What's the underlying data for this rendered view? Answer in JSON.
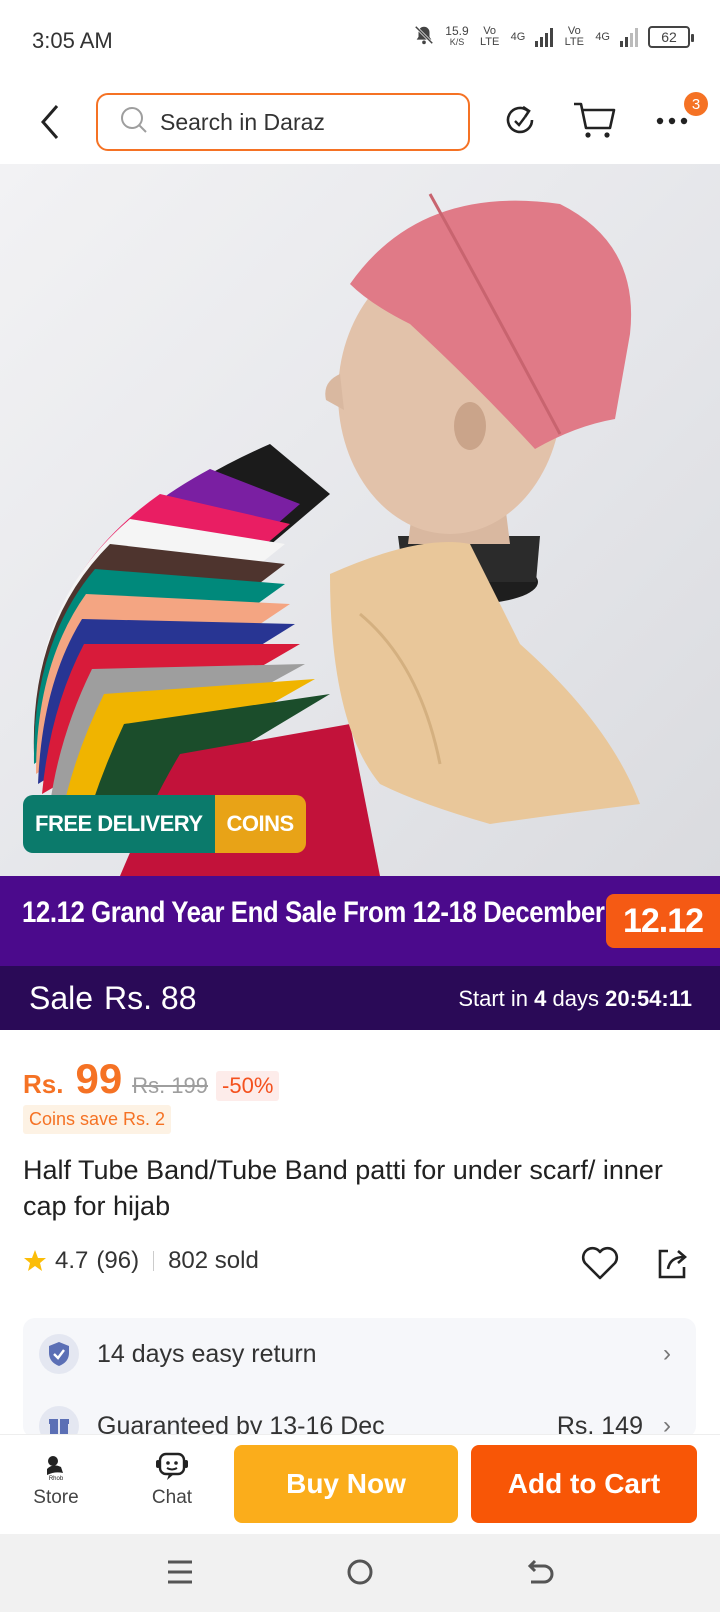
{
  "status_bar": {
    "time": "3:05 AM",
    "net_speed": "15.9",
    "net_unit": "K/S",
    "sim1_label": "Vo LTE",
    "sim1_network": "4G",
    "sim2_label": "Vo LTE",
    "sim2_network": "4G",
    "battery": "62"
  },
  "top_nav": {
    "search_placeholder": "Search in Daraz",
    "more_badge": "3"
  },
  "product_image": {
    "badges": {
      "free_delivery": "FREE DELIVERY",
      "coins": "COINS"
    },
    "colors": {
      "free_delivery": "#0b7a6b",
      "coins": "#e8a317"
    }
  },
  "campaign": {
    "banner_text": "12.12 Grand Year End Sale From 12-18 December",
    "logo_text": "12.12",
    "sale_label": "Sale",
    "sale_price": "Rs. 88",
    "start_prefix": "Start in",
    "start_days": "4",
    "start_days_label": "days",
    "start_time": "20:54:11"
  },
  "price": {
    "currency": "Rs.",
    "amount": "99",
    "original": "Rs. 199",
    "discount": "-50%",
    "coins_save": "Coins save Rs. 2"
  },
  "product": {
    "title": "Half Tube Band/Tube Band patti for under scarf/ inner cap for hijab",
    "rating": "4.7",
    "reviews": "(96)",
    "sold": "802 sold"
  },
  "services": [
    {
      "label": "14 days easy return",
      "icon": "shield-check-icon"
    },
    {
      "label": "Guaranteed by 13-16 Dec",
      "price": "Rs. 149",
      "icon": "gift-icon"
    }
  ],
  "bottom_bar": {
    "store_label": "Store",
    "chat_label": "Chat",
    "buy_now": "Buy Now",
    "add_to_cart": "Add to Cart"
  },
  "theme": {
    "accent": "#f57224",
    "buy_now": "#fbad1b",
    "add_to_cart": "#f85606",
    "campaign": "#4b0a8c"
  }
}
